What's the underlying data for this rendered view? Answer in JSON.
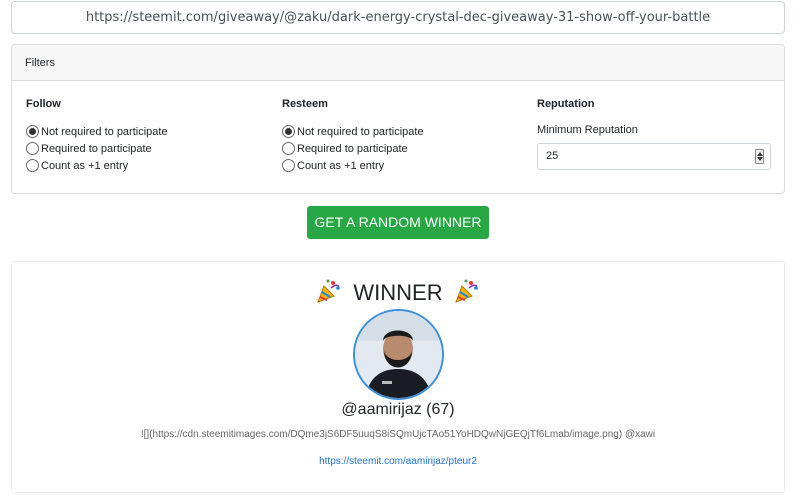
{
  "url_field": {
    "value": "https://steemit.com/giveaway/@zaku/dark-energy-crystal-dec-giveaway-31-show-off-your-battle"
  },
  "filters": {
    "header": "Filters",
    "follow": {
      "title": "Follow",
      "options": [
        {
          "label": "Not required to participate",
          "checked": true
        },
        {
          "label": "Required to participate",
          "checked": false
        },
        {
          "label": "Count as +1 entry",
          "checked": false
        }
      ]
    },
    "resteem": {
      "title": "Resteem",
      "options": [
        {
          "label": "Not required to participate",
          "checked": true
        },
        {
          "label": "Required to participate",
          "checked": false
        },
        {
          "label": "Count as +1 entry",
          "checked": false
        }
      ]
    },
    "reputation": {
      "title": "Reputation",
      "label": "Minimum Reputation",
      "value": "25"
    }
  },
  "action": {
    "button_label": "GET A RANDOM WINNER",
    "button_color": "#28a745"
  },
  "winner": {
    "title": "WINNER",
    "title_icon": "party-popper-icon",
    "name": "@aamirijaz (67)",
    "comment": "![](https://cdn.steemitimages.com/DQme3jS6DF5uuqS8iSQmUjcTAo51YoHDQwNjGEQjTf6Lmab/image.png) @xawi",
    "link": "https://steemit.com/aamirijaz/pteur2",
    "avatar_border_color": "#3c8fdc"
  }
}
